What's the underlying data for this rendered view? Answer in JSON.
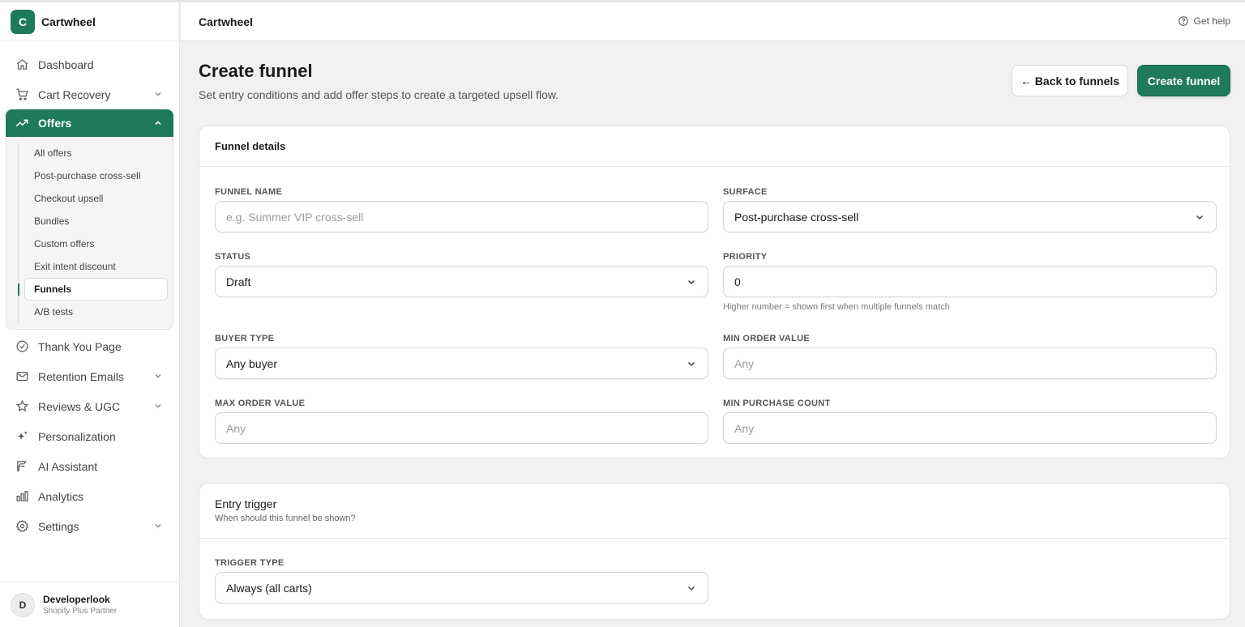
{
  "app": {
    "logo_letter": "C",
    "name": "Cartwheel"
  },
  "nav": {
    "items_top": [
      {
        "label": "Dashboard",
        "icon": "home-icon"
      },
      {
        "label": "Cart Recovery",
        "icon": "cart-icon",
        "has_chevron": true
      }
    ],
    "active": {
      "label": "Offers",
      "icon": "trending-up-icon"
    },
    "sub_items": [
      "All offers",
      "Post-purchase cross-sell",
      "Checkout upsell",
      "Bundles",
      "Custom offers",
      "Exit intent discount",
      "Funnels",
      "A/B tests"
    ],
    "current_sub": "Funnels",
    "items_bottom": [
      {
        "label": "Thank You Page",
        "icon": "check-circle-icon"
      },
      {
        "label": "Retention Emails",
        "icon": "mail-icon",
        "has_chevron": true
      },
      {
        "label": "Reviews & UGC",
        "icon": "star-icon",
        "has_chevron": true
      },
      {
        "label": "Personalization",
        "icon": "sparkles-icon"
      },
      {
        "label": "AI Assistant",
        "icon": "ai-icon"
      },
      {
        "label": "Analytics",
        "icon": "bar-chart-icon"
      },
      {
        "label": "Settings",
        "icon": "gear-icon",
        "has_chevron": true
      }
    ]
  },
  "profile": {
    "initial": "D",
    "name": "Developerlook",
    "role": "Shopify Plus Partner"
  },
  "header": {
    "title": "Cartwheel",
    "help": "Get help"
  },
  "page": {
    "title": "Create funnel",
    "subtitle": "Set entry conditions and add offer steps to create a targeted upsell flow.",
    "back_button": "← Back to funnels",
    "create_button": "Create funnel"
  },
  "funnel_details": {
    "title": "Funnel details",
    "funnel_name": {
      "label": "FUNNEL NAME",
      "placeholder": "e.g. Summer VIP cross-sell",
      "value": ""
    },
    "surface": {
      "label": "SURFACE",
      "value": "Post-purchase cross-sell"
    },
    "status": {
      "label": "STATUS",
      "value": "Draft"
    },
    "priority": {
      "label": "PRIORITY",
      "value": "0",
      "hint": "Higher number = shown first when multiple funnels match"
    },
    "buyer_type": {
      "label": "BUYER TYPE",
      "value": "Any buyer"
    },
    "min_order_value": {
      "label": "MIN ORDER VALUE",
      "placeholder": "Any"
    },
    "max_order_value": {
      "label": "MAX ORDER VALUE",
      "placeholder": "Any"
    },
    "min_purchase_count": {
      "label": "MIN PURCHASE COUNT",
      "placeholder": "Any"
    }
  },
  "entry_trigger": {
    "title": "Entry trigger",
    "description": "When should this funnel be shown?",
    "trigger_type": {
      "label": "TRIGGER TYPE",
      "value": "Always (all carts)"
    }
  },
  "colors": {
    "accent": "#1f7a5c",
    "background": "#f1f1f1"
  }
}
